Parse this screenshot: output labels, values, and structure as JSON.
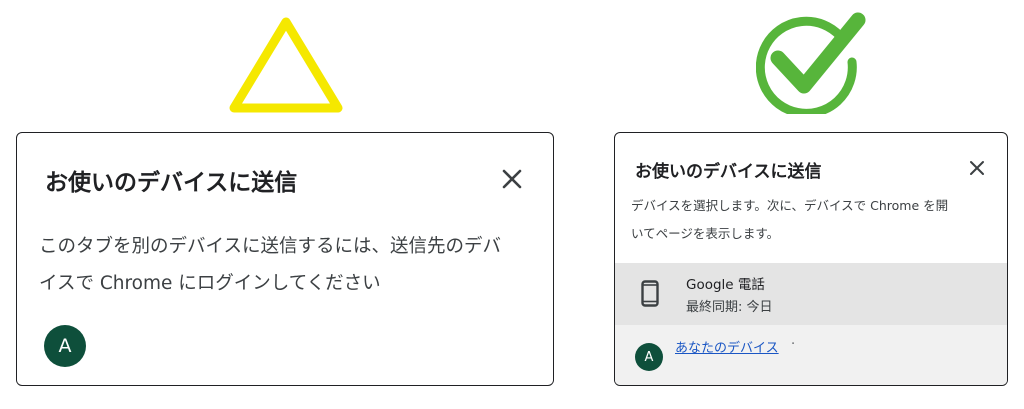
{
  "colors": {
    "warning": "#f5e800",
    "success": "#57b53b",
    "avatar": "#0e4f3b",
    "link": "#1a56c4"
  },
  "icons": {
    "warning_mark": "triangle-icon",
    "success_mark": "check-circle-icon",
    "close": "close-icon",
    "device": "smartphone-icon"
  },
  "before_dialog": {
    "title": "お使いのデバイスに送信",
    "body_line1": "このタブを別のデバイスに送信するには、送信先のデバ",
    "body_line2": "イスで Chrome にログインしてください",
    "avatar_initial": "A"
  },
  "after_dialog": {
    "title": "お使いのデバイスに送信",
    "body_line1": "デバイスを選択します。次に、デバイスで Chrome を開",
    "body_line2": "いてページを表示します。",
    "device": {
      "name": "Google 電話",
      "last_sync": "最終同期: 今日"
    },
    "avatar_initial": "A",
    "your_devices_link": "あなたのデバイス",
    "separator": "·"
  }
}
